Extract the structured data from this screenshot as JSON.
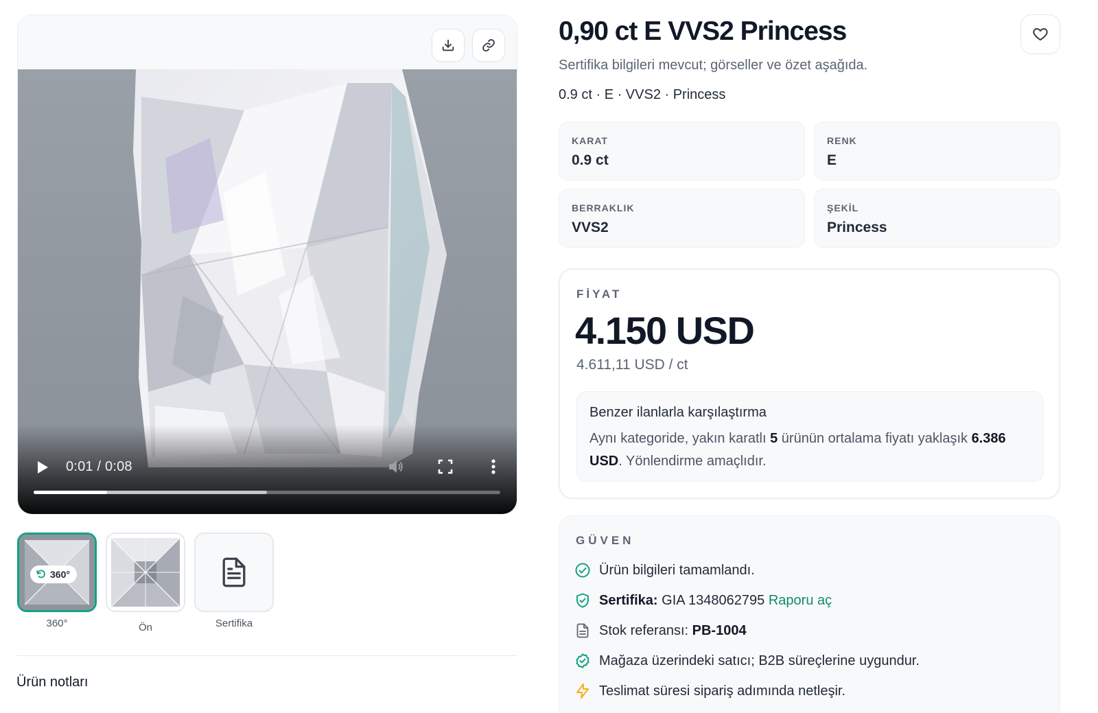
{
  "media": {
    "video": {
      "current_time": "0:01",
      "duration": "0:08",
      "time_display": "0:01 / 0:08",
      "played_fraction": 0.157,
      "buffered_fraction": 0.5
    },
    "thumbnails": [
      {
        "label": "360°",
        "badge": "360°",
        "selected": true
      },
      {
        "label": "Ön",
        "selected": false
      },
      {
        "label": "Sertifika",
        "icon": "document-icon",
        "selected": false
      }
    ]
  },
  "notes": {
    "title": "Ürün notları"
  },
  "product": {
    "title": "0,90 ct E VVS2 Princess",
    "subtitle": "Sertifika bilgileri mevcut; görseller ve özet aşağıda.",
    "spec_line": "0.9 ct · E · VVS2 · Princess",
    "specs": [
      {
        "label": "KARAT",
        "value": "0.9 ct"
      },
      {
        "label": "RENK",
        "value": "E"
      },
      {
        "label": "BERRAKLIK",
        "value": "VVS2"
      },
      {
        "label": "ŞEKİL",
        "value": "Princess"
      }
    ]
  },
  "price": {
    "label": "FİYAT",
    "value": "4.150 USD",
    "per_carat": "4.611,11 USD / ct",
    "comparison": {
      "title": "Benzer ilanlarla karşılaştırma",
      "text_before": "Aynı kategoride, yakın karatlı ",
      "count": "5",
      "text_middle": " ürünün ortalama fiyatı yaklaşık ",
      "average": "6.386 USD",
      "text_after": ". Yönlendirme amaçlıdır."
    }
  },
  "trust": {
    "label": "GÜVEN",
    "items": [
      {
        "icon": "check-circle-icon",
        "text": "Ürün bilgileri tamamlandı."
      },
      {
        "icon": "shield-check-icon",
        "strong": "Sertifika:",
        "text": " GIA 1348062795 ",
        "link": "Raporu aç"
      },
      {
        "icon": "document-icon",
        "text": "Stok referansı: ",
        "strong_after": "PB-1004"
      },
      {
        "icon": "badge-check-icon",
        "text": "Mağaza üzerindeki satıcı; B2B süreçlerine uygundur."
      },
      {
        "icon": "bolt-icon",
        "text": "Teslimat süresi sipariş adımında netleşir."
      }
    ]
  },
  "colors": {
    "accent": "#14a085",
    "link": "#128a6e",
    "warning": "#f5b01a",
    "text": "#111827",
    "muted": "#5b6472"
  }
}
